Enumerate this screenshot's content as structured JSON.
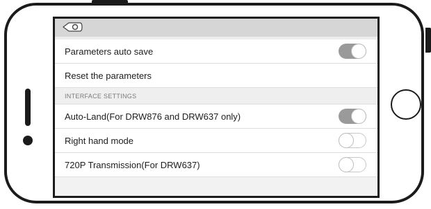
{
  "settings": {
    "rows": [
      {
        "label": "Parameters auto save",
        "toggle": "on"
      },
      {
        "label": "Reset the parameters"
      }
    ],
    "section": {
      "title": "INTERFACE SETTINGS"
    },
    "interface_rows": [
      {
        "label": "Auto-Land(For DRW876 and DRW637 only)",
        "toggle": "on"
      },
      {
        "label": "Right hand mode",
        "toggle": "off"
      },
      {
        "label": "720P Transmission(For DRW637)",
        "toggle": "off"
      }
    ]
  },
  "icons": {
    "back": "back-arrow-icon"
  }
}
